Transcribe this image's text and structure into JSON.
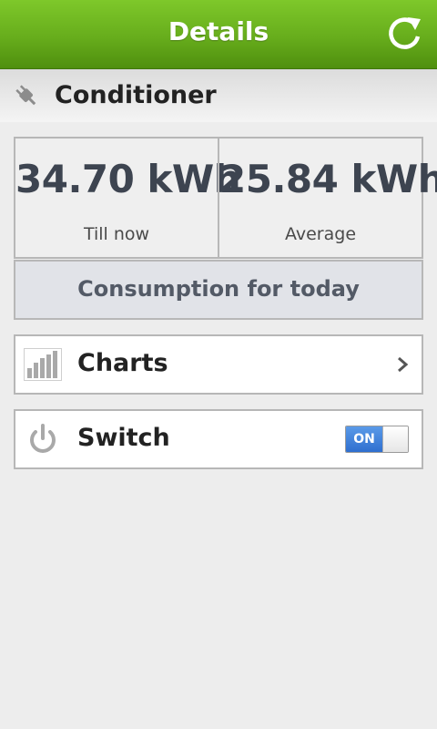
{
  "header": {
    "title": "Details",
    "refresh_icon": "refresh-icon",
    "background_color": "#6ab41f"
  },
  "device": {
    "icon": "plug-icon",
    "name": "Conditioner"
  },
  "stats": {
    "till_now": {
      "value": "34.70 kWh",
      "label": "Till now"
    },
    "average": {
      "value": "25.84 kWh",
      "label": "Average"
    }
  },
  "consumption_button": {
    "label": "Consumption for today"
  },
  "charts_row": {
    "icon": "bar-chart-icon",
    "label": "Charts",
    "chevron_icon": "chevron-right-icon"
  },
  "switch_row": {
    "icon": "power-icon",
    "label": "Switch",
    "toggle": {
      "state": "ON",
      "on_color": "#3b7dde"
    }
  }
}
